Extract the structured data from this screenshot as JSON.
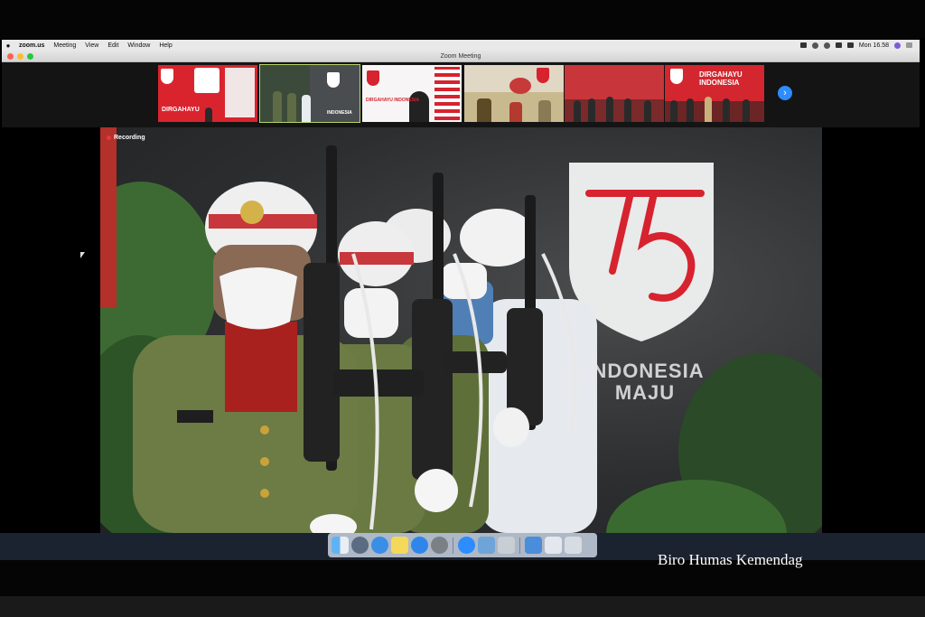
{
  "menubar": {
    "app": "zoom.us",
    "items": [
      "Meeting",
      "View",
      "Edit",
      "Window",
      "Help"
    ],
    "clock": "Mon 16.58"
  },
  "window": {
    "title": "Zoom Meeting"
  },
  "gallery": {
    "thumbnails": [
      {
        "label": "DIRGAHAYU"
      },
      {
        "label": "INDONESIA"
      },
      {
        "label": "DIRGAHAYU INDONESIA"
      },
      {
        "label": ""
      },
      {
        "label": ""
      },
      {
        "label": "DIRGAHAYU INDONESIA"
      }
    ]
  },
  "main_video": {
    "recording_label": "Recording",
    "logo_number": "75",
    "brand_line1": "INDONESIA",
    "brand_line2": "MAJU"
  },
  "colors": {
    "brand_red": "#d6232f",
    "zoom_blue": "#2d8cff"
  },
  "dock": {
    "icons": [
      "finder-icon",
      "launchpad-icon",
      "safari-icon",
      "notes-icon",
      "app-store-icon",
      "system-preferences-icon",
      "zoom-icon",
      "keynote-icon",
      "preview-icon",
      "downloads-icon",
      "folder-icon",
      "trash-icon"
    ]
  },
  "caption": "Biro Humas Kemendag"
}
